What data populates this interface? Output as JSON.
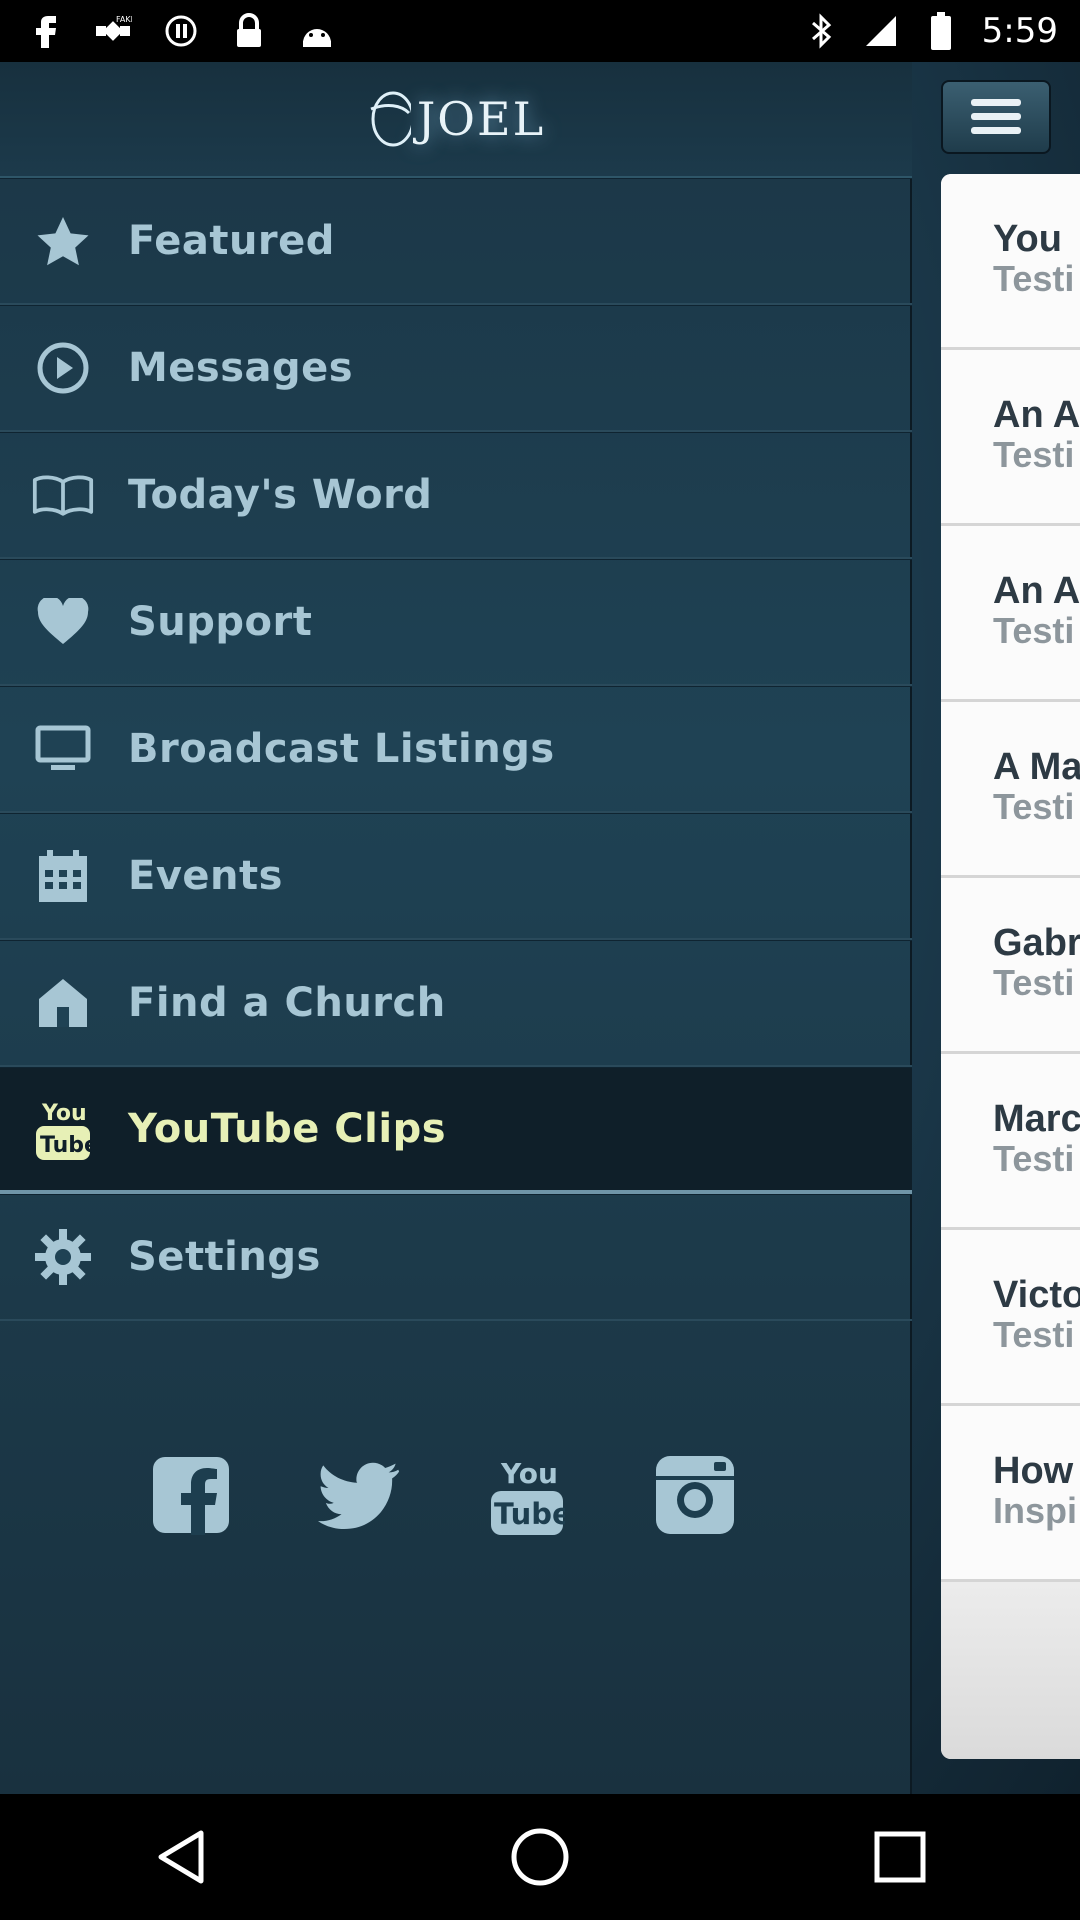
{
  "status_bar": {
    "time": "5:59",
    "icons": [
      "facebook-notification-icon",
      "fake-gps-icon",
      "media-icon",
      "lock-icon",
      "android-icon"
    ],
    "right_icons": [
      "bluetooth-icon",
      "signal-icon",
      "battery-icon"
    ]
  },
  "app": {
    "logo_text": "JOEL"
  },
  "menu": {
    "items": [
      {
        "label": "Featured",
        "icon": "star-icon"
      },
      {
        "label": "Messages",
        "icon": "play-icon"
      },
      {
        "label": "Today's Word",
        "icon": "book-icon"
      },
      {
        "label": "Support",
        "icon": "heart-icon"
      },
      {
        "label": "Broadcast Listings",
        "icon": "tv-icon"
      },
      {
        "label": "Events",
        "icon": "calendar-icon"
      },
      {
        "label": "Find a Church",
        "icon": "house-icon"
      },
      {
        "label": "YouTube Clips",
        "icon": "youtube-icon",
        "active": true
      },
      {
        "label": "Settings",
        "icon": "gear-icon"
      }
    ]
  },
  "social": [
    "facebook-icon",
    "twitter-icon",
    "youtube-icon",
    "instagram-icon"
  ],
  "peek_list": [
    {
      "title": "You",
      "sub": "Testi"
    },
    {
      "title": "An A",
      "sub": "Testi"
    },
    {
      "title": "An A",
      "sub": "Testi"
    },
    {
      "title": "A Ma",
      "sub": "Testi"
    },
    {
      "title": "Gabr",
      "sub": "Testi"
    },
    {
      "title": "Marc",
      "sub": "Testi"
    },
    {
      "title": "Victo",
      "sub": "Testi"
    },
    {
      "title": "How",
      "sub": "Inspi"
    }
  ],
  "colors": {
    "drawer_bg": "#1f4254",
    "menu_text": "#a7c6d4",
    "active_text": "#e7f0b6"
  }
}
